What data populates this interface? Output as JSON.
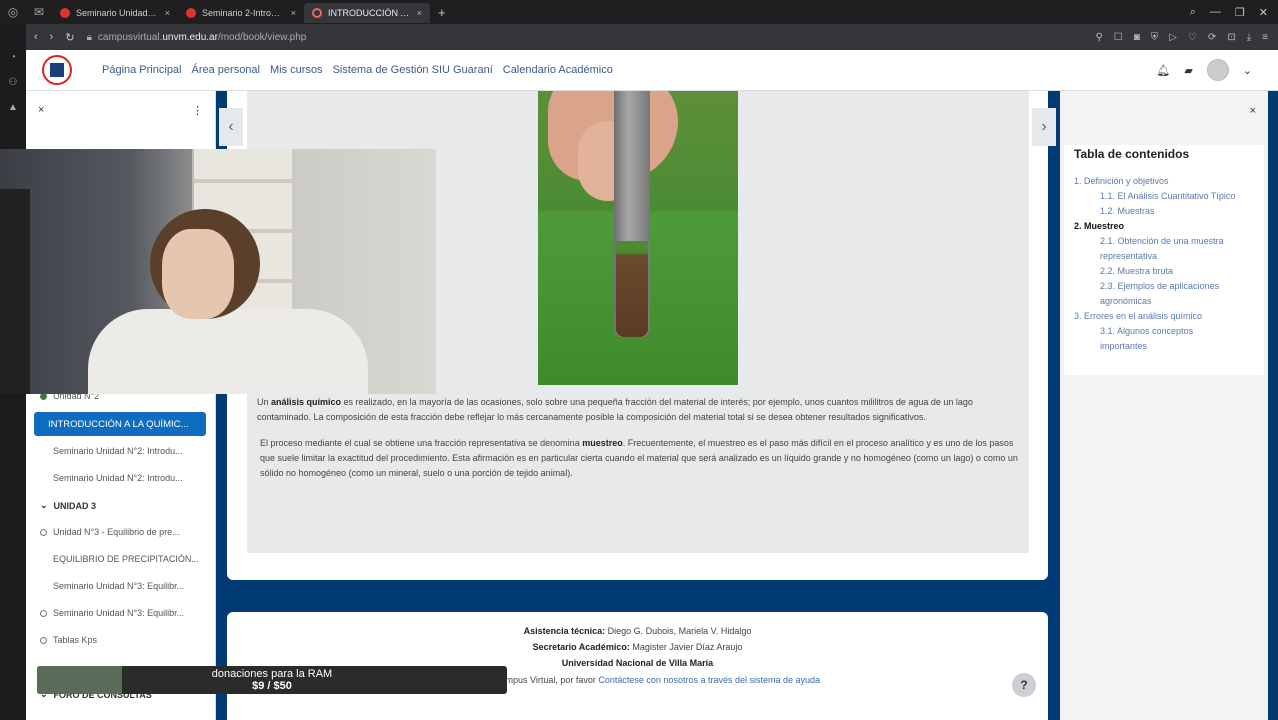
{
  "browser": {
    "tabs": [
      {
        "label": "Seminario Unidad N°2: In",
        "active": false
      },
      {
        "label": "Seminario 2-Introducción",
        "active": false
      },
      {
        "label": "INTRODUCCIÓN A LA QU",
        "active": true
      }
    ],
    "new_tab": "+",
    "url_prefix": "campusvirtual.",
    "url_host": "unvm.edu.ar",
    "url_path": "/mod/book/view.php"
  },
  "navbar": {
    "links": [
      "Página Principal",
      "Área personal",
      "Mis cursos",
      "Sistema de Gestión SIU Guaraní",
      "Calendario Académico"
    ]
  },
  "drawer": {
    "close": "×",
    "menu": "⋮",
    "items": [
      {
        "label": "Unidad N°2",
        "type": "done"
      },
      {
        "label": "INTRODUCCIÓN A LA QUÍMIC...",
        "type": "active"
      },
      {
        "label": "Seminario Unidad N°2: Introdu...",
        "type": "indent"
      },
      {
        "label": "Seminario Unidad N°2: Introdu...",
        "type": "indent"
      },
      {
        "label": "UNIDAD 3",
        "type": "section"
      },
      {
        "label": "Unidad N°3 - Equilibrio de pre...",
        "type": "todo"
      },
      {
        "label": "EQUILIBRIO DE PRECIPITACIÓN...",
        "type": "indent"
      },
      {
        "label": "Seminario Unidad N°3: Equilibr...",
        "type": "indent"
      },
      {
        "label": "Seminario Unidad N°3: Equilibr...",
        "type": "todo"
      },
      {
        "label": "Tablas Kps",
        "type": "todo"
      },
      {
        "label": "FORO DE CONSULTAS",
        "type": "section"
      }
    ]
  },
  "content": {
    "p1_pre": "Un ",
    "p1_bold": "análisis químico",
    "p1_post": " es realizado, en la mayoría de las ocasiones, solo sobre una pequeña fracción del material de interés; por ejemplo, unos cuantos mililitros de agua de un lago contaminado. La composición de esta fracción debe reflejar lo más cercanamente posible la composición del material total si se desea obtener resultados significativos.",
    "p2_pre": "El proceso mediante el cual se obtiene una fracción representativa se denomina ",
    "p2_bold": "muestreo",
    "p2_post": ". Frecuentemente, el muestreo es el paso más difícil en el proceso analítico y es uno de los pasos que suele limitar la exactitud del procedimiento. Esta afirmación es en particular cierta cuando el material que será analizado es un líquido grande y no homogéneo (como un lago) o como un sólido no homogéneo (como un mineral, suelo o una porción de tejido animal).",
    "prev": "‹",
    "next": "›"
  },
  "toc": {
    "close": "×",
    "title": "Tabla de contenidos",
    "items": [
      {
        "label": "1. Definición y objetivos",
        "level": 1,
        "bold": false
      },
      {
        "label": "1.1. El Análisis Cuantitativo Típico",
        "level": 2,
        "bold": false
      },
      {
        "label": "1.2. Muestras",
        "level": 2,
        "bold": false
      },
      {
        "label": "2. Muestreo",
        "level": 1,
        "bold": true
      },
      {
        "label": "2.1. Obtención de una muestra",
        "level": 2,
        "bold": false
      },
      {
        "label": "representativa",
        "level": 2,
        "bold": false
      },
      {
        "label": "2.2. Muestra bruta",
        "level": 2,
        "bold": false
      },
      {
        "label": "2.3. Ejemplos de aplicaciones",
        "level": 2,
        "bold": false
      },
      {
        "label": "agronómicas",
        "level": 2,
        "bold": false
      },
      {
        "label": "3. Errores en el análisis químico",
        "level": 1,
        "bold": false
      },
      {
        "label": "3.1. Algunos conceptos",
        "level": 2,
        "bold": false
      },
      {
        "label": "importantes",
        "level": 2,
        "bold": false
      }
    ]
  },
  "footer": {
    "asist_label": "Asistencia técnica:",
    "asist_value": " Diego G. Dubois,  Mariela V. Hidalgo",
    "sec_label": "Secretario Académico:",
    "sec_value": " Magister Javier Díaz Araujo",
    "uni": "Universidad Nacional de Villa María",
    "contact_pre": "feridas al Campus Virtual, por favor ",
    "contact_link": "Contáctese con nosotros a través del sistema de ayuda",
    "help": "?"
  },
  "donation": {
    "line1": "donaciones para la RAM",
    "line2": "$9 / $50",
    "progress": 0.18
  }
}
